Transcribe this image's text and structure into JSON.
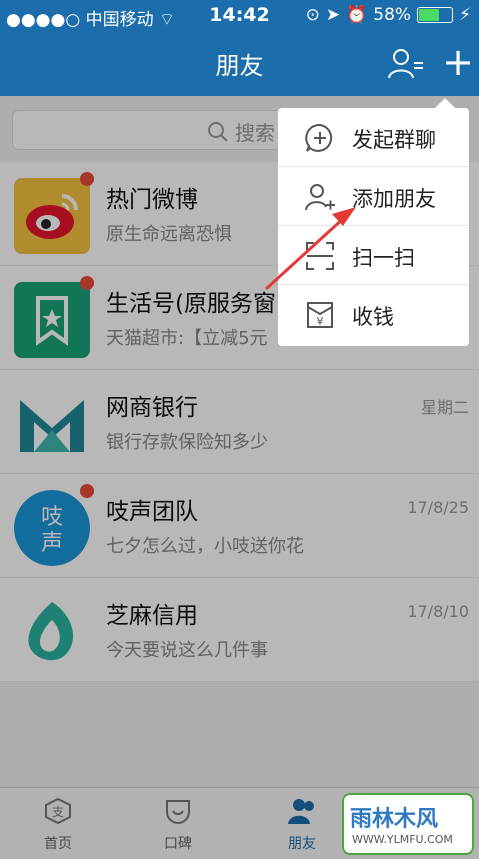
{
  "status_bar": {
    "carrier": "●●●●○ 中国移动",
    "time": "14:42",
    "battery": "58%"
  },
  "header": {
    "title": "朋友"
  },
  "search": {
    "placeholder": "搜索"
  },
  "conversations": [
    {
      "name": "热门微博",
      "preview": "原生命远离恐惧",
      "time": "",
      "unread": true
    },
    {
      "name": "生活号(原服务窗",
      "preview": "天猫超市:【立减5元",
      "time": "",
      "unread": true
    },
    {
      "name": "网商银行",
      "preview": "银行存款保险知多少",
      "time": "星期二",
      "unread": false
    },
    {
      "name": "吱声团队",
      "preview": "七夕怎么过，小吱送你花",
      "time": "17/8/25",
      "unread": true
    },
    {
      "name": "芝麻信用",
      "preview": "今天要说这么几件事",
      "time": "17/8/10",
      "unread": false
    }
  ],
  "popup_menu": [
    {
      "label": "发起群聊",
      "icon": "chat-plus-icon"
    },
    {
      "label": "添加朋友",
      "icon": "add-friend-icon"
    },
    {
      "label": "扫一扫",
      "icon": "scan-icon"
    },
    {
      "label": "收钱",
      "icon": "receive-money-icon"
    }
  ],
  "tabs": [
    {
      "label": "首页",
      "icon": "home-icon"
    },
    {
      "label": "口碑",
      "icon": "koubei-icon"
    },
    {
      "label": "朋友",
      "icon": "friends-icon",
      "active": true
    }
  ],
  "watermark": {
    "text": "雨林木风",
    "url": "WWW.YLMFU.COM"
  },
  "colors": {
    "header_blue": "#1c6dab",
    "badge_red": "#e84c3d",
    "arrow_red": "#e53935"
  }
}
